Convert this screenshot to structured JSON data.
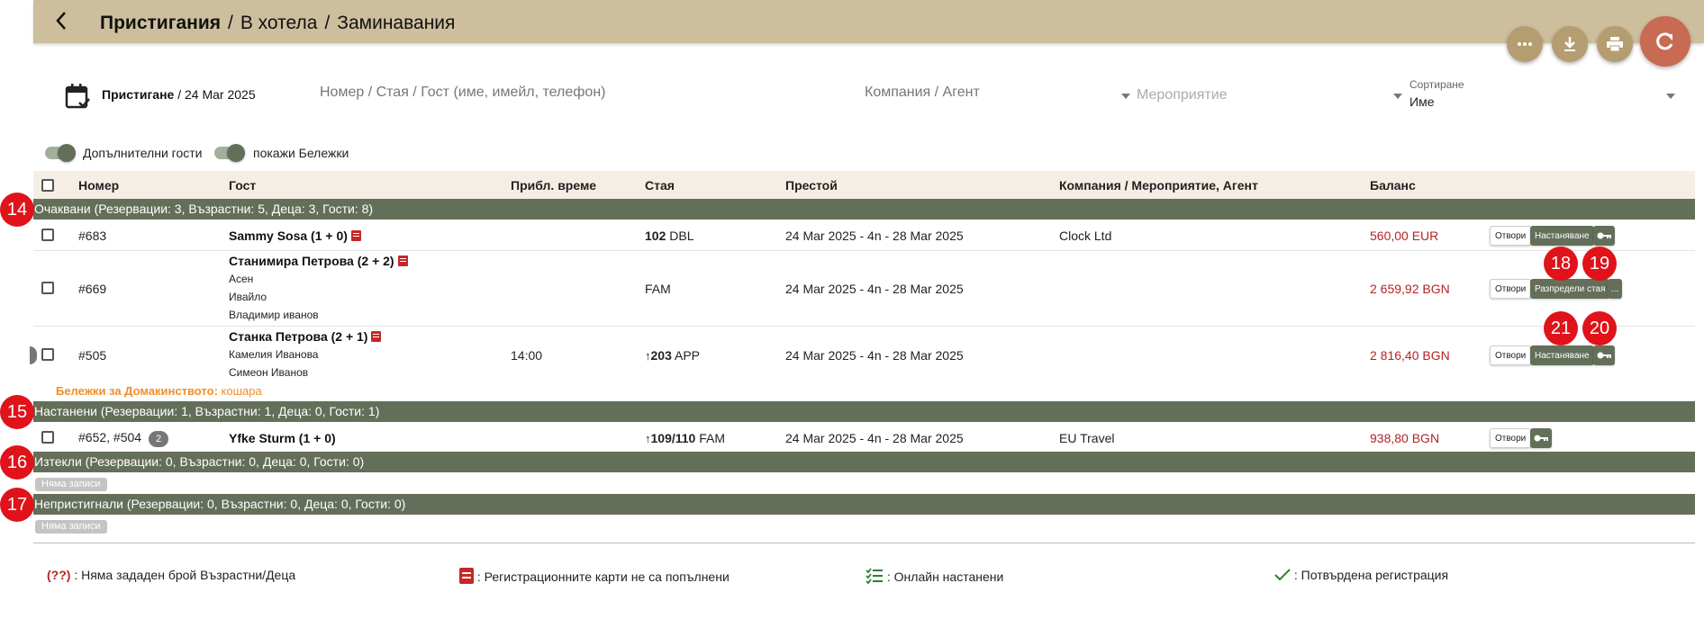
{
  "header": {
    "breadcrumb": [
      "Пристигания",
      "В хотела",
      "Заминавания"
    ],
    "separator": "/"
  },
  "toolbar": {
    "more_icon": "more-horizontal-icon",
    "download_icon": "download-icon",
    "print_icon": "print-icon",
    "refresh_icon": "refresh-icon"
  },
  "filters": {
    "date_label": "Пристигане",
    "date_value": " / 24 Мar 2025",
    "search_placeholder": "Номер / Стая / Гост (име, имейл, телефон)",
    "company_placeholder": "Компания / Агент",
    "event_placeholder": "Мероприятие",
    "sort_label": "Сортиране",
    "sort_value": "Име"
  },
  "toggles": {
    "extra_guests": "Допълнителни гости",
    "show_notes": "покажи Бележки"
  },
  "table": {
    "columns": [
      "Номер",
      "Гост",
      "Прибл. време",
      "Стая",
      "Престой",
      "Компания / Мероприятие, Агент",
      "Баланс"
    ]
  },
  "groups": {
    "expected": {
      "badge": "14",
      "label": "Очаквани (Резервации: 3, Възрастни: 5, Деца: 3, Гости: 8)"
    },
    "in_house": {
      "badge": "15",
      "label": "Настанени (Резервации: 1, Възрастни: 1, Деца: 0, Гости: 1)"
    },
    "expired": {
      "badge": "16",
      "label": "Изтекли (Резервации: 0, Възрастни: 0, Деца: 0, Гости: 0)"
    },
    "no_show": {
      "badge": "17",
      "label": "Непристигнали (Резервации: 0, Възрастни: 0, Деца: 0, Гости: 0)"
    }
  },
  "rows": [
    {
      "number": "#683",
      "guest": "Sammy Sosa (1 + 0)",
      "companions": [],
      "time": "",
      "room_num": "102",
      "room_type": " DBL",
      "stay": "24 Мar 2025 - 4n - 28 Мar 2025",
      "company": "Clock Ltd",
      "balance": "560,00 EUR",
      "btn_open": "Отвори",
      "btn_action": "Настаняване"
    },
    {
      "number": "#669",
      "guest": "Станимира Петрова (2 + 2)",
      "companions": [
        "Асен",
        "Ивайло",
        "Владимир иванов"
      ],
      "time": "",
      "room_num": "",
      "room_type": "FAM",
      "stay": "24 Мar 2025 - 4n - 28 Мar 2025",
      "company": "",
      "balance": "2 659,92 BGN",
      "btn_open": "Отвори",
      "btn_action": "Разпредели стая",
      "btn_more": "...",
      "badge_a": "18",
      "badge_b": "19"
    },
    {
      "number": "#505",
      "guest": "Станка Петрова (2 + 1)",
      "companions": [
        "Камелия Иванова",
        "Симеон Иванов"
      ],
      "time": "14:00",
      "room_num": "203",
      "room_type": " APP",
      "stay": "24 Мar 2025 - 4n - 28 Мar 2025",
      "company": "",
      "balance": "2 816,40 BGN",
      "btn_open": "Отвори",
      "btn_action": "Настаняване",
      "badge_a": "21",
      "badge_b": "20"
    },
    {
      "number": "#652, #504",
      "count": "2",
      "guest": "Yfke Sturm (1 + 0)",
      "companions": [],
      "time": "",
      "room_num": "109/110",
      "room_type": " FAM",
      "stay": "24 Мar 2025 - 4n - 28 Мar 2025",
      "company": "EU Travel",
      "balance": "938,80 BGN",
      "btn_open": "Отвори"
    }
  ],
  "housekeeping_note": {
    "label": "Бележки за Домакинството:",
    "value": " кошара"
  },
  "no_records": "Няма записи",
  "legend": {
    "qq": "(??)",
    "qq_text": " : Няма зададен брой Възрастни/Деца",
    "regcard_text": " : Регистрационните карти не са попълнени",
    "online_text": " : Онлайн настанени",
    "confirmed_text": " : Потвърдена регистрация"
  },
  "colors": {
    "topbar": "#cdbf9d",
    "group_bar": "#646f5a",
    "refresh": "#c96a52",
    "balance": "#b32424",
    "badge": "#e0131a",
    "note": "#f28c28"
  }
}
